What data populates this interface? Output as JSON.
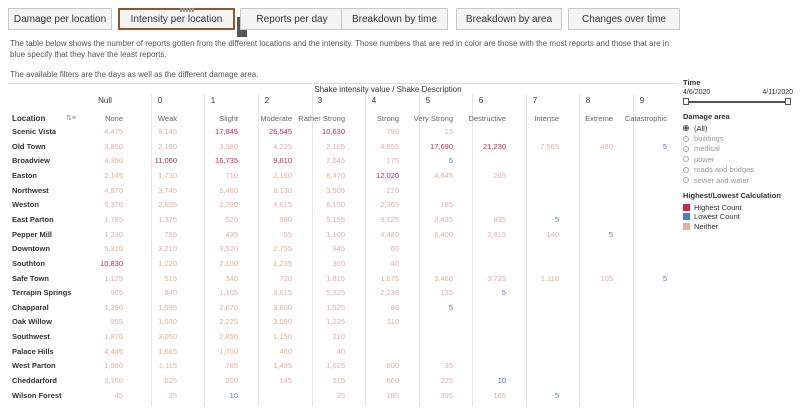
{
  "tabs": [
    {
      "label": "Damage per location",
      "active": false
    },
    {
      "label": "Intensity per location",
      "active": true
    },
    {
      "label": "Reports per day",
      "active": false
    },
    {
      "label": "Breakdown by time",
      "active": false
    },
    {
      "label": "Breakdown by area",
      "active": false
    },
    {
      "label": "Changes over time",
      "active": false
    }
  ],
  "tab_close_glyph": "✕",
  "description": {
    "line1": "The table below shows the number of reports gotten from the different locations and the intensity. Those numbers that are red in color are those with the most reports and those that are in blue specify that they have the least reports.",
    "line2": "The available filters are the days as well as the different damage area."
  },
  "table": {
    "column_title": "Shake intensity value / Shake Description",
    "row_header": "Location",
    "columns": [
      {
        "num": "Null",
        "desc": "None"
      },
      {
        "num": "0",
        "desc": "Weak"
      },
      {
        "num": "1",
        "desc": "Slight"
      },
      {
        "num": "2",
        "desc": "Moderate"
      },
      {
        "num": "3",
        "desc": "Rather Strong"
      },
      {
        "num": "4",
        "desc": "Strong"
      },
      {
        "num": "5",
        "desc": "Very Strong"
      },
      {
        "num": "6",
        "desc": "Destructive"
      },
      {
        "num": "7",
        "desc": "Intense"
      },
      {
        "num": "8",
        "desc": "Extreme"
      },
      {
        "num": "9",
        "desc": "Catastrophic"
      }
    ],
    "rows": [
      {
        "location": "Scenic Vista",
        "cells": [
          [
            "4,475",
            "n"
          ],
          [
            "9,145",
            "n"
          ],
          [
            "17,845",
            "h"
          ],
          [
            "26,545",
            "h"
          ],
          [
            "10,630",
            "h"
          ],
          [
            "790",
            "n"
          ],
          [
            "15",
            "n"
          ],
          null,
          null,
          null,
          null
        ]
      },
      {
        "location": "Old Town",
        "cells": [
          [
            "3,850",
            "n"
          ],
          [
            "2,190",
            "n"
          ],
          [
            "3,380",
            "n"
          ],
          [
            "4,225",
            "n"
          ],
          [
            "2,105",
            "n"
          ],
          [
            "4,955",
            "n"
          ],
          [
            "17,690",
            "h"
          ],
          [
            "21,230",
            "h"
          ],
          [
            "7,565",
            "n"
          ],
          [
            "480",
            "n"
          ],
          [
            "5",
            "l"
          ]
        ]
      },
      {
        "location": "Broadview",
        "cells": [
          [
            "4,350",
            "n"
          ],
          [
            "11,060",
            "h"
          ],
          [
            "16,735",
            "h"
          ],
          [
            "9,610",
            "h"
          ],
          [
            "2,045",
            "n"
          ],
          [
            "175",
            "n"
          ],
          [
            "5",
            "l"
          ],
          null,
          null,
          null,
          null
        ]
      },
      {
        "location": "Easton",
        "cells": [
          [
            "2,145",
            "n"
          ],
          [
            "1,730",
            "n"
          ],
          [
            "710",
            "n"
          ],
          [
            "2,160",
            "n"
          ],
          [
            "8,470",
            "n"
          ],
          [
            "12,020",
            "h"
          ],
          [
            "4,645",
            "n"
          ],
          [
            "265",
            "n"
          ],
          null,
          null,
          null
        ]
      },
      {
        "location": "Northwest",
        "cells": [
          [
            "4,870",
            "n"
          ],
          [
            "3,745",
            "n"
          ],
          [
            "6,480",
            "n"
          ],
          [
            "8,130",
            "n"
          ],
          [
            "3,505",
            "n"
          ],
          [
            "220",
            "n"
          ],
          null,
          null,
          null,
          null,
          null
        ]
      },
      {
        "location": "Weston",
        "cells": [
          [
            "5,370",
            "n"
          ],
          [
            "2,655",
            "n"
          ],
          [
            "2,290",
            "n"
          ],
          [
            "4,615",
            "n"
          ],
          [
            "6,150",
            "n"
          ],
          [
            "2,365",
            "n"
          ],
          [
            "185",
            "n"
          ],
          null,
          null,
          null,
          null
        ]
      },
      {
        "location": "East Parton",
        "cells": [
          [
            "1,785",
            "n"
          ],
          [
            "1,375",
            "n"
          ],
          [
            "520",
            "n"
          ],
          [
            "990",
            "n"
          ],
          [
            "5,155",
            "n"
          ],
          [
            "9,125",
            "n"
          ],
          [
            "3,435",
            "n"
          ],
          [
            "835",
            "n"
          ],
          [
            "5",
            "l"
          ],
          null,
          null
        ]
      },
      {
        "location": "Pepper Mill",
        "cells": [
          [
            "1,230",
            "n"
          ],
          [
            "755",
            "n"
          ],
          [
            "435",
            "n"
          ],
          [
            "95",
            "n"
          ],
          [
            "1,160",
            "n"
          ],
          [
            "4,480",
            "n"
          ],
          [
            "6,400",
            "n"
          ],
          [
            "2,615",
            "n"
          ],
          [
            "140",
            "n"
          ],
          [
            "5",
            "l"
          ],
          null
        ]
      },
      {
        "location": "Downtown",
        "cells": [
          [
            "5,310",
            "n"
          ],
          [
            "3,210",
            "n"
          ],
          [
            "3,520",
            "n"
          ],
          [
            "2,755",
            "n"
          ],
          [
            "945",
            "n"
          ],
          [
            "60",
            "n"
          ],
          null,
          null,
          null,
          null,
          null
        ]
      },
      {
        "location": "Southton",
        "cells": [
          [
            "10,830",
            "h"
          ],
          [
            "1,220",
            "n"
          ],
          [
            "2,100",
            "n"
          ],
          [
            "1,235",
            "n"
          ],
          [
            "300",
            "n"
          ],
          [
            "40",
            "n"
          ],
          null,
          null,
          null,
          null,
          null
        ]
      },
      {
        "location": "Safe Town",
        "cells": [
          [
            "1,125",
            "n"
          ],
          [
            "515",
            "n"
          ],
          [
            "340",
            "n"
          ],
          [
            "720",
            "n"
          ],
          [
            "1,815",
            "n"
          ],
          [
            "1,675",
            "n"
          ],
          [
            "3,460",
            "n"
          ],
          [
            "3,725",
            "n"
          ],
          [
            "1,110",
            "n"
          ],
          [
            "105",
            "n"
          ],
          [
            "5",
            "l"
          ]
        ]
      },
      {
        "location": "Terrapin Springs",
        "cells": [
          [
            "965",
            "n"
          ],
          [
            "840",
            "n"
          ],
          [
            "1,105",
            "n"
          ],
          [
            "3,615",
            "n"
          ],
          [
            "5,325",
            "n"
          ],
          [
            "2,230",
            "n"
          ],
          [
            "135",
            "n"
          ],
          [
            "5",
            "l"
          ],
          null,
          null,
          null
        ]
      },
      {
        "location": "Chapparal",
        "cells": [
          [
            "1,390",
            "n"
          ],
          [
            "1,595",
            "n"
          ],
          [
            "2,670",
            "n"
          ],
          [
            "3,800",
            "n"
          ],
          [
            "1,525",
            "n"
          ],
          [
            "80",
            "n"
          ],
          [
            "5",
            "l"
          ],
          null,
          null,
          null,
          null
        ]
      },
      {
        "location": "Oak Willow",
        "cells": [
          [
            "955",
            "n"
          ],
          [
            "1,030",
            "n"
          ],
          [
            "2,225",
            "n"
          ],
          [
            "3,090",
            "n"
          ],
          [
            "1,225",
            "n"
          ],
          [
            "110",
            "n"
          ],
          null,
          null,
          null,
          null,
          null
        ]
      },
      {
        "location": "Southwest",
        "cells": [
          [
            "1,870",
            "n"
          ],
          [
            "3,050",
            "n"
          ],
          [
            "2,850",
            "n"
          ],
          [
            "1,150",
            "n"
          ],
          [
            "210",
            "n"
          ],
          null,
          null,
          null,
          null,
          null,
          null
        ]
      },
      {
        "location": "Palace Hills",
        "cells": [
          [
            "4,445",
            "n"
          ],
          [
            "1,665",
            "n"
          ],
          [
            "1,700",
            "n"
          ],
          [
            "460",
            "n"
          ],
          [
            "40",
            "n"
          ],
          null,
          null,
          null,
          null,
          null,
          null
        ]
      },
      {
        "location": "West Parton",
        "cells": [
          [
            "1,960",
            "n"
          ],
          [
            "1,115",
            "n"
          ],
          [
            "765",
            "n"
          ],
          [
            "1,435",
            "n"
          ],
          [
            "1,625",
            "n"
          ],
          [
            "600",
            "n"
          ],
          [
            "35",
            "n"
          ],
          null,
          null,
          null,
          null
        ]
      },
      {
        "location": "Cheddarford",
        "cells": [
          [
            "3,750",
            "n"
          ],
          [
            "625",
            "n"
          ],
          [
            "200",
            "n"
          ],
          [
            "145",
            "n"
          ],
          [
            "515",
            "n"
          ],
          [
            "660",
            "n"
          ],
          [
            "225",
            "n"
          ],
          [
            "10",
            "l"
          ],
          null,
          null,
          null
        ]
      },
      {
        "location": "Wilson Forest",
        "cells": [
          [
            "45",
            "n"
          ],
          [
            "35",
            "n"
          ],
          [
            "10",
            "l"
          ],
          null,
          [
            "25",
            "n"
          ],
          [
            "185",
            "n"
          ],
          [
            "395",
            "n"
          ],
          [
            "165",
            "n"
          ],
          [
            "5",
            "l"
          ],
          null,
          null
        ]
      }
    ]
  },
  "filters": {
    "time": {
      "title": "Time",
      "start": "4/6/2020",
      "end": "4/11/2020"
    },
    "damage_area": {
      "title": "Damage area",
      "options": [
        {
          "label": "(All)",
          "selected": true
        },
        {
          "label": "buildings",
          "selected": false
        },
        {
          "label": "medical",
          "selected": false
        },
        {
          "label": "power",
          "selected": false
        },
        {
          "label": "roads and bridges",
          "selected": false
        },
        {
          "label": "sewer and water",
          "selected": false
        }
      ]
    },
    "legend": {
      "title": "Highest/Lowest Calculation",
      "items": [
        {
          "label": "Highest Count",
          "color": "#d0284b"
        },
        {
          "label": "Lowest Count",
          "color": "#4f7fc4"
        },
        {
          "label": "Neither",
          "color": "#e8b0a0"
        }
      ]
    }
  }
}
